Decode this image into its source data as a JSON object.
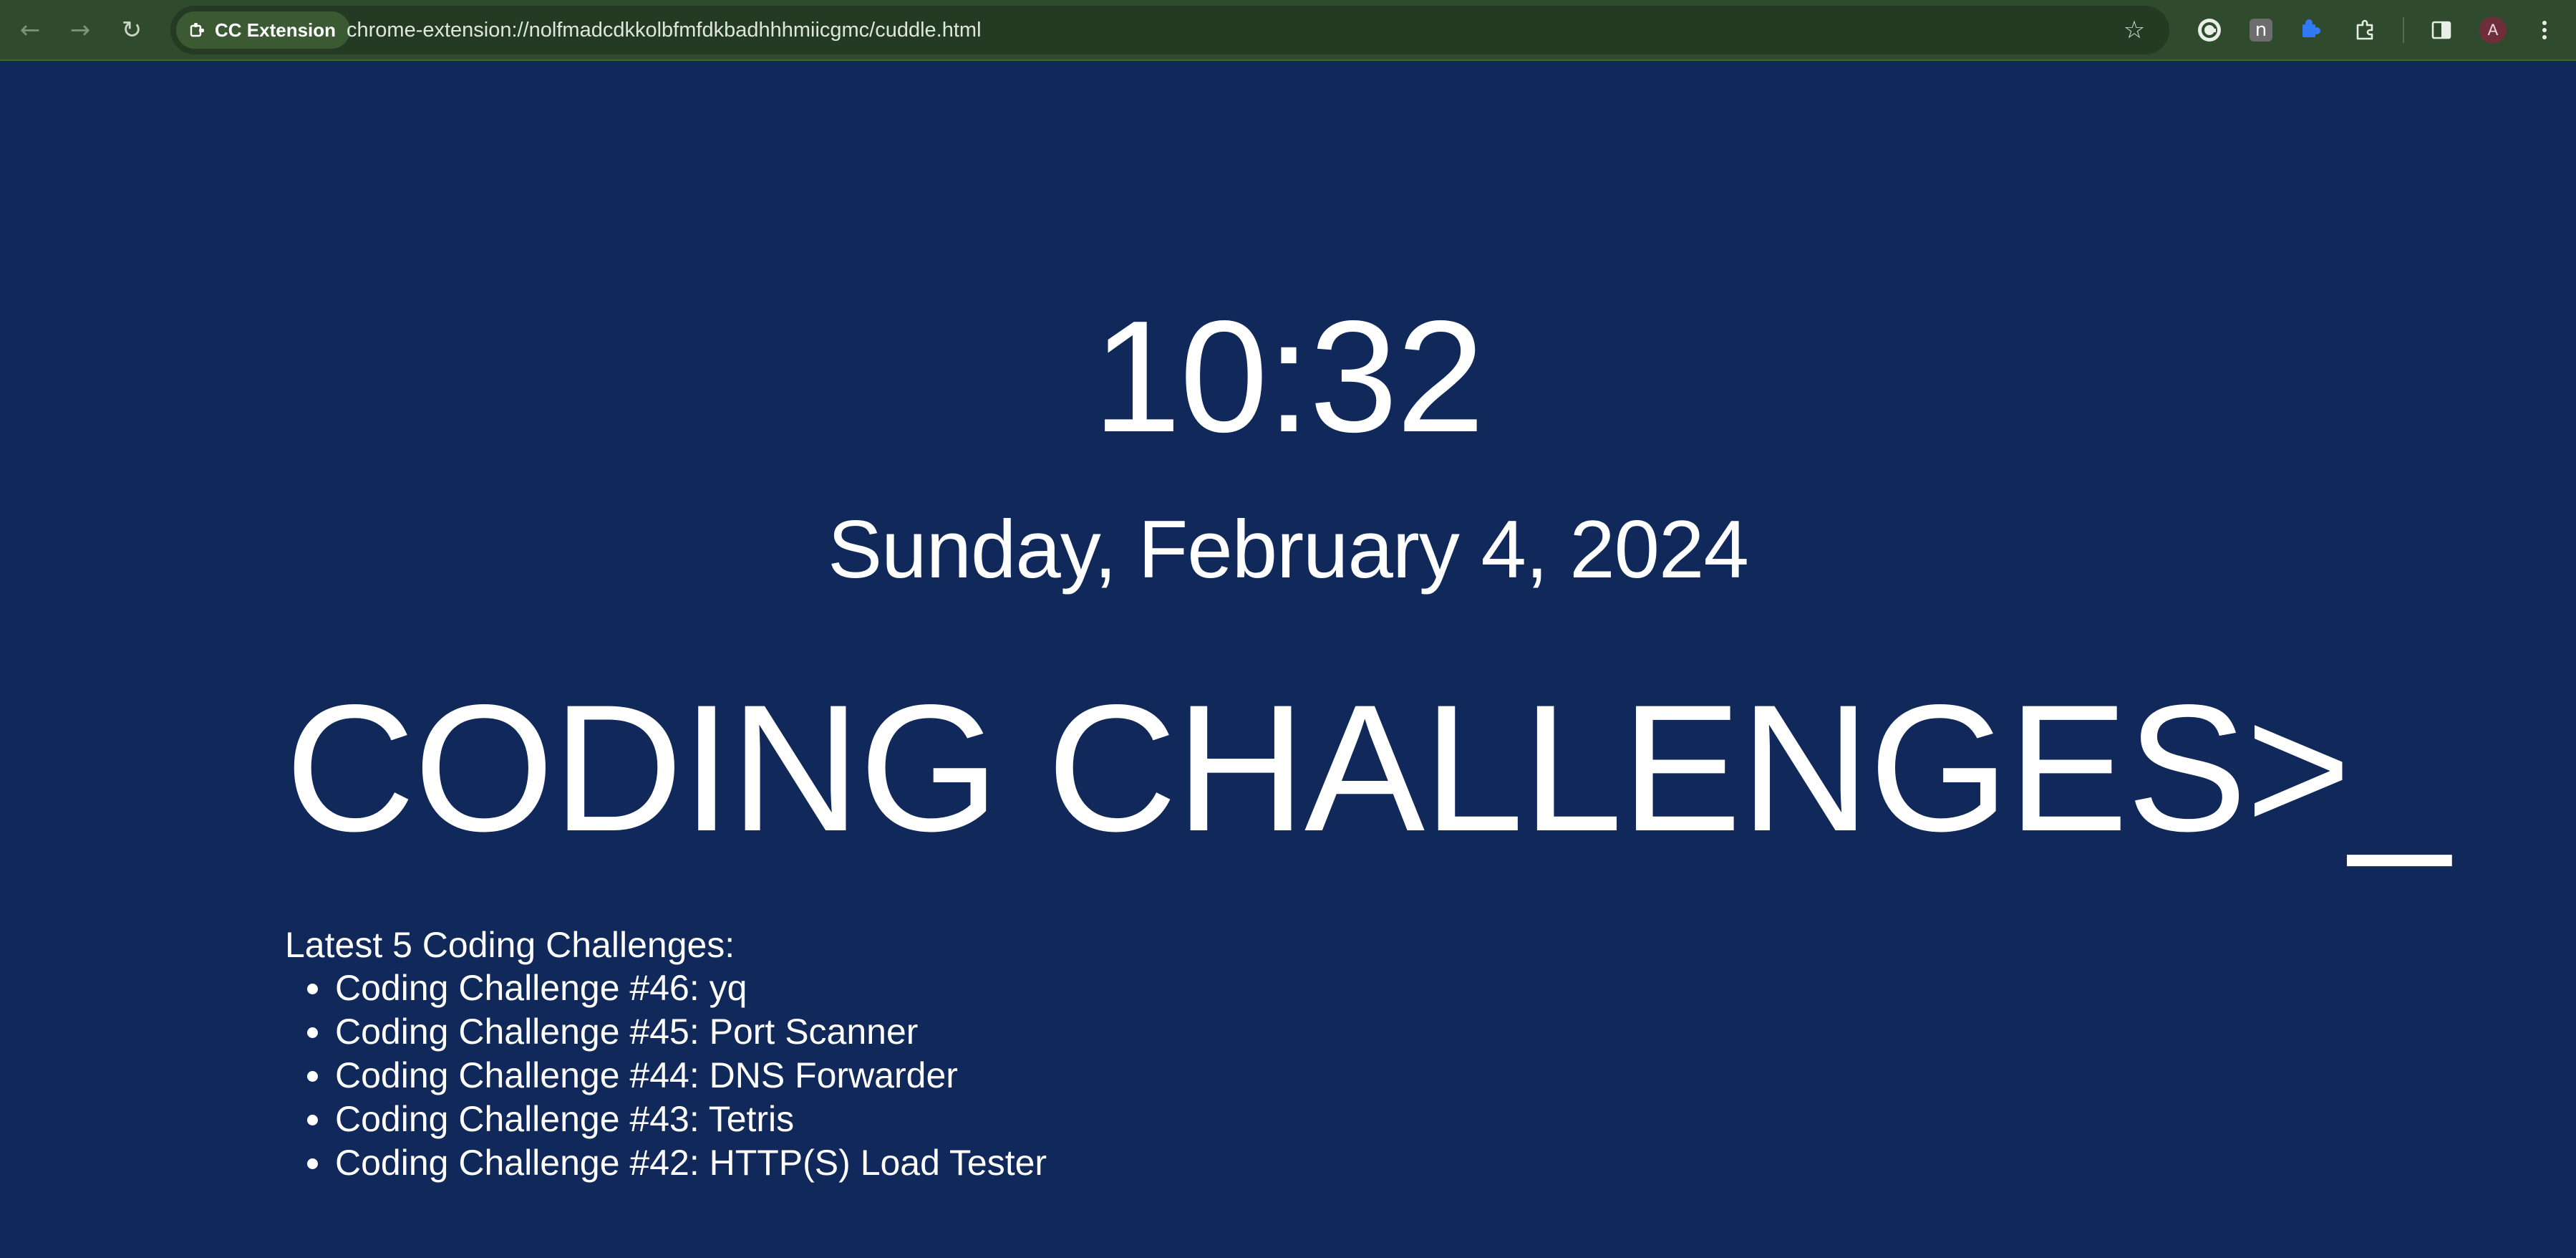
{
  "browser": {
    "extension_chip_label": "CC Extension",
    "url": "chrome-extension://nolfmadcdkkolbfmfdkbadhhhmiicgmc/cuddle.html",
    "profile_initial": "A",
    "extension_n_label": "n",
    "colors": {
      "toolbar": "#2f4a2c",
      "omnibox": "#243a22"
    }
  },
  "page": {
    "time": "10:32",
    "date": "Sunday, February 4, 2024",
    "title": "CODING CHALLENGES>_",
    "latest_heading": "Latest 5 Coding Challenges:",
    "challenges": [
      "Coding Challenge #46: yq",
      "Coding Challenge #45: Port Scanner",
      "Coding Challenge #44: DNS Forwarder",
      "Coding Challenge #43: Tetris",
      "Coding Challenge #42: HTTP(S) Load Tester"
    ],
    "colors": {
      "background": "#10285a",
      "text": "#ffffff"
    }
  },
  "icons": {
    "back": "arrow-left-icon",
    "forward": "arrow-right-icon",
    "reload": "reload-icon",
    "extension_chip": "puzzle-icon",
    "bookmark": "star-icon",
    "grammarly": "grammarly-icon",
    "extensions": "extensions-puzzle-icon",
    "side_panel": "side-panel-icon",
    "menu": "kebab-menu-icon"
  }
}
